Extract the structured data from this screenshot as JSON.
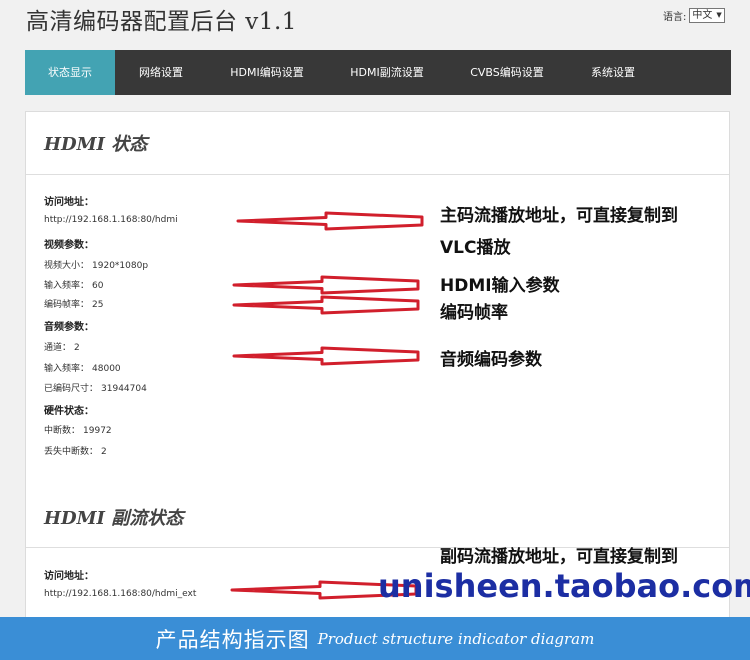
{
  "header": {
    "title": "高清编码器配置后台 v1.1",
    "lang_label": "语言:",
    "lang_value": "中文"
  },
  "nav": {
    "tabs": [
      {
        "label": "状态显示",
        "active": true
      },
      {
        "label": "网络设置",
        "active": false
      },
      {
        "label": "HDMI编码设置",
        "active": false
      },
      {
        "label": "HDMI副流设置",
        "active": false
      },
      {
        "label": "CVBS编码设置",
        "active": false
      },
      {
        "label": "系统设置",
        "active": false
      }
    ]
  },
  "hdmi_status": {
    "title": "HDMI 状态",
    "access_label": "访问地址：",
    "access_url": "http://192.168.1.168:80/hdmi",
    "video_label": "视频参数：",
    "video_size_label": "视频大小：",
    "video_size": "1920*1080p",
    "input_rate_label": "输入频率：",
    "input_rate": "60",
    "encode_fps_label": "编码帧率：",
    "encode_fps": "25",
    "audio_label": "音频参数：",
    "channel_label": "通道：",
    "channel": "2",
    "audio_rate_label": "输入频率：",
    "audio_rate": "48000",
    "encoded_size_label": "已编码尺寸：",
    "encoded_size": "31944704",
    "hw_label": "硬件状态：",
    "interrupts_label": "中断数：",
    "interrupts": "19972",
    "lost_interrupts_label": "丢失中断数：",
    "lost_interrupts": "2"
  },
  "hdmi_sub_status": {
    "title": "HDMI 副流状态",
    "access_label": "访问地址：",
    "access_url": "http://192.168.1.168:80/hdmi_ext"
  },
  "annotations": {
    "main_stream_1": "主码流播放地址，可直接复制到",
    "main_stream_2": "VLC播放",
    "hdmi_input": "HDMI输入参数",
    "encode_fps": "编码帧率",
    "audio_encode": "音频编码参数",
    "sub_stream_1": "副码流播放地址，可直接复制到"
  },
  "watermark": "unisheen.taobao.com",
  "footer": {
    "zh": "产品结构指示图",
    "en": "Product structure indicator diagram"
  },
  "colors": {
    "nav_bg": "#383838",
    "nav_active": "#43a3b3",
    "arrow_red": "#d11f2c",
    "footer_bg": "#3a8ed6",
    "watermark": "#1c2ea3"
  }
}
